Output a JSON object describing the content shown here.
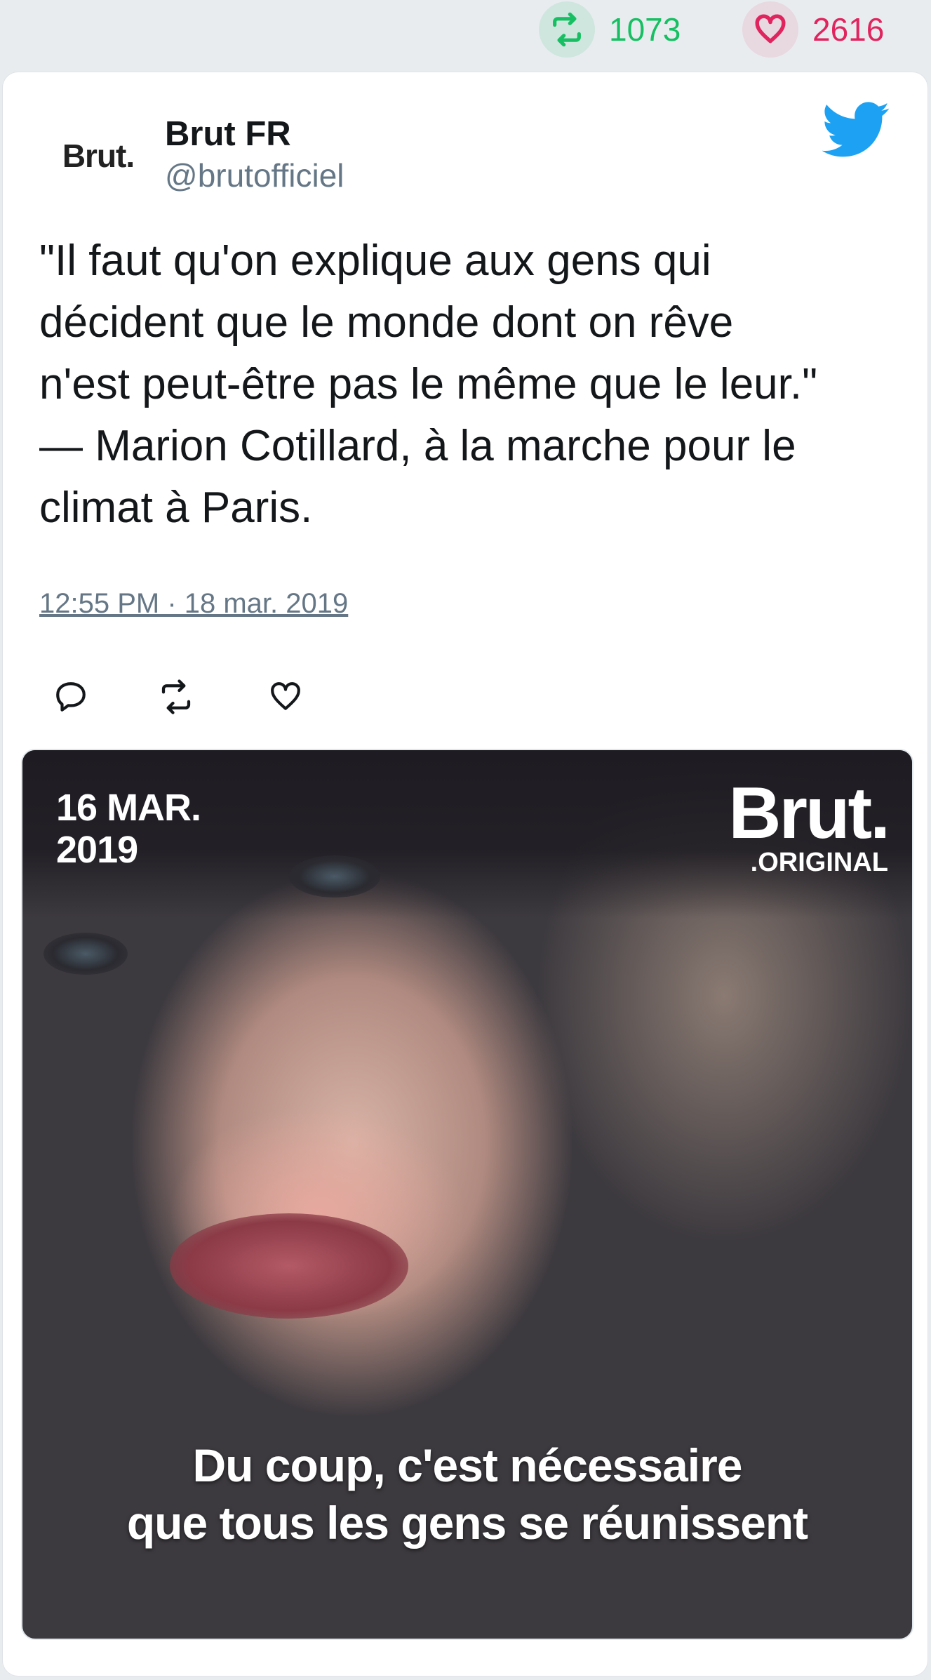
{
  "stats": {
    "retweets": "1073",
    "likes": "2616",
    "retweet_icon": "retweet-icon",
    "like_icon": "heart-icon",
    "retweet_color": "#17bf63",
    "like_color": "#e0245e"
  },
  "tweet": {
    "author_name": "Brut FR",
    "author_handle": "@brutofficiel",
    "avatar_text": "Brut.",
    "text_lines": [
      "\"Il faut qu'on explique aux gens qui",
      "décident que le monde dont on rêve",
      "n'est peut-être pas le même que le leur.\"",
      "— Marion Cotillard, à la marche pour le",
      "climat à Paris."
    ],
    "timestamp": "12:55 PM · 18 mar. 2019",
    "actions": [
      "reply-icon",
      "retweet-icon",
      "like-icon"
    ],
    "brand_icon": "twitter-bird-icon",
    "brand_color": "#1da1f2"
  },
  "media": {
    "date_line1": "16 MAR.",
    "date_line2": "2019",
    "logo_big": "Brut.",
    "logo_small": ".ORIGINAL",
    "caption_line1": "Du coup, c'est nécessaire",
    "caption_line2": "que tous les gens se réunissent"
  }
}
